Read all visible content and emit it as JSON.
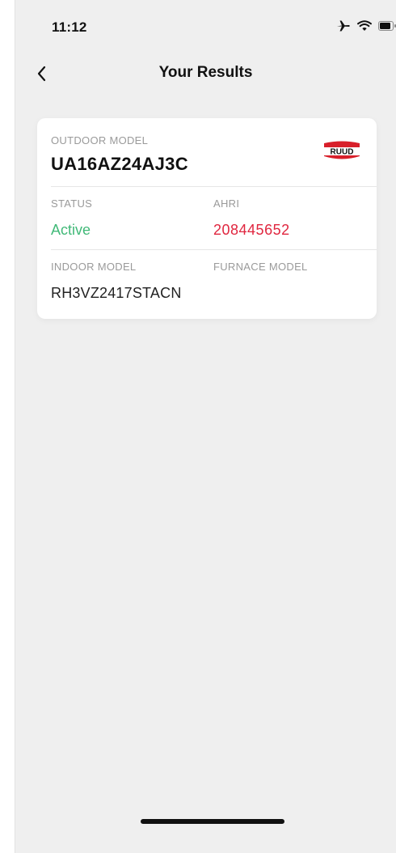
{
  "status_bar": {
    "time": "11:12",
    "icons": [
      "airplane-icon",
      "wifi-icon",
      "battery-icon"
    ]
  },
  "nav": {
    "title": "Your Results",
    "back_icon": "chevron-left-icon"
  },
  "result": {
    "outdoor_model_label": "OUTDOOR MODEL",
    "outdoor_model_value": "UA16AZ24AJ3C",
    "brand": "RUUD",
    "status_label": "STATUS",
    "status_value": "Active",
    "ahri_label": "AHRI",
    "ahri_value": "208445652",
    "indoor_model_label": "INDOOR MODEL",
    "indoor_model_value": "RH3VZ2417STACN",
    "furnace_model_label": "FURNACE MODEL",
    "furnace_model_value": ""
  },
  "colors": {
    "background": "#efefef",
    "active": "#41b978",
    "ahri": "#e0263f",
    "brand_red": "#d81f2a"
  }
}
